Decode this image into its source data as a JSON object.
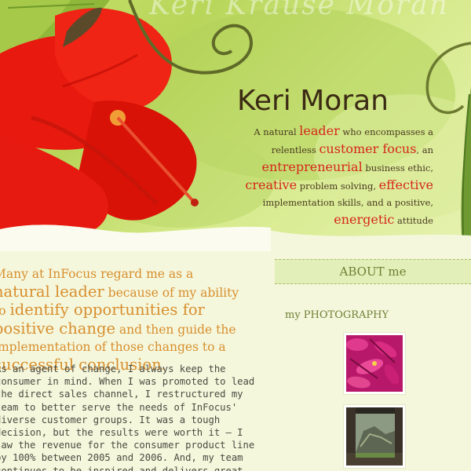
{
  "header": {
    "watermark": "Keri Krause Moran",
    "name": "Keri Moran",
    "tagline": {
      "t1": "A natural ",
      "h1": "leader",
      "t2": " who encompasses a relentless ",
      "h2": "customer focus",
      "t3": ", an ",
      "h3": "entrepreneurial",
      "t4": " business ethic, ",
      "h4": "creative",
      "t5": " problem solving, ",
      "h5": "effective",
      "t6": " implementation skills, and a positive, ",
      "h6": "energetic",
      "t7": " attitude"
    }
  },
  "intro": {
    "p1": "Many at InFocus regard me as a ",
    "b1": "natural leader",
    "p2": " because of my ability to ",
    "b2": "identify opportunities for positive change",
    "p3": " and then guide the implementation of those changes to a ",
    "b3": "successful conclusion",
    "p4": "."
  },
  "body": {
    "paragraph": "As an agent of change, I always keep the consumer in mind. When I was promoted to lead the direct sales channel, I restructured my team to better serve the needs of InFocus' diverse customer groups. It was a tough decision, but the results were worth it — I saw the revenue for the consumer product line by 100% between 2005 and 2006. And, my team continues to be inspired and delivers great results, every single day."
  },
  "sidebar": {
    "about_label": "ABOUT me",
    "photo_heading": "my PHOTOGRAPHY"
  },
  "colors": {
    "accent_red": "#d6261c",
    "intro_orange": "#d88e2e",
    "sidebar_green": "#6f7f34"
  }
}
